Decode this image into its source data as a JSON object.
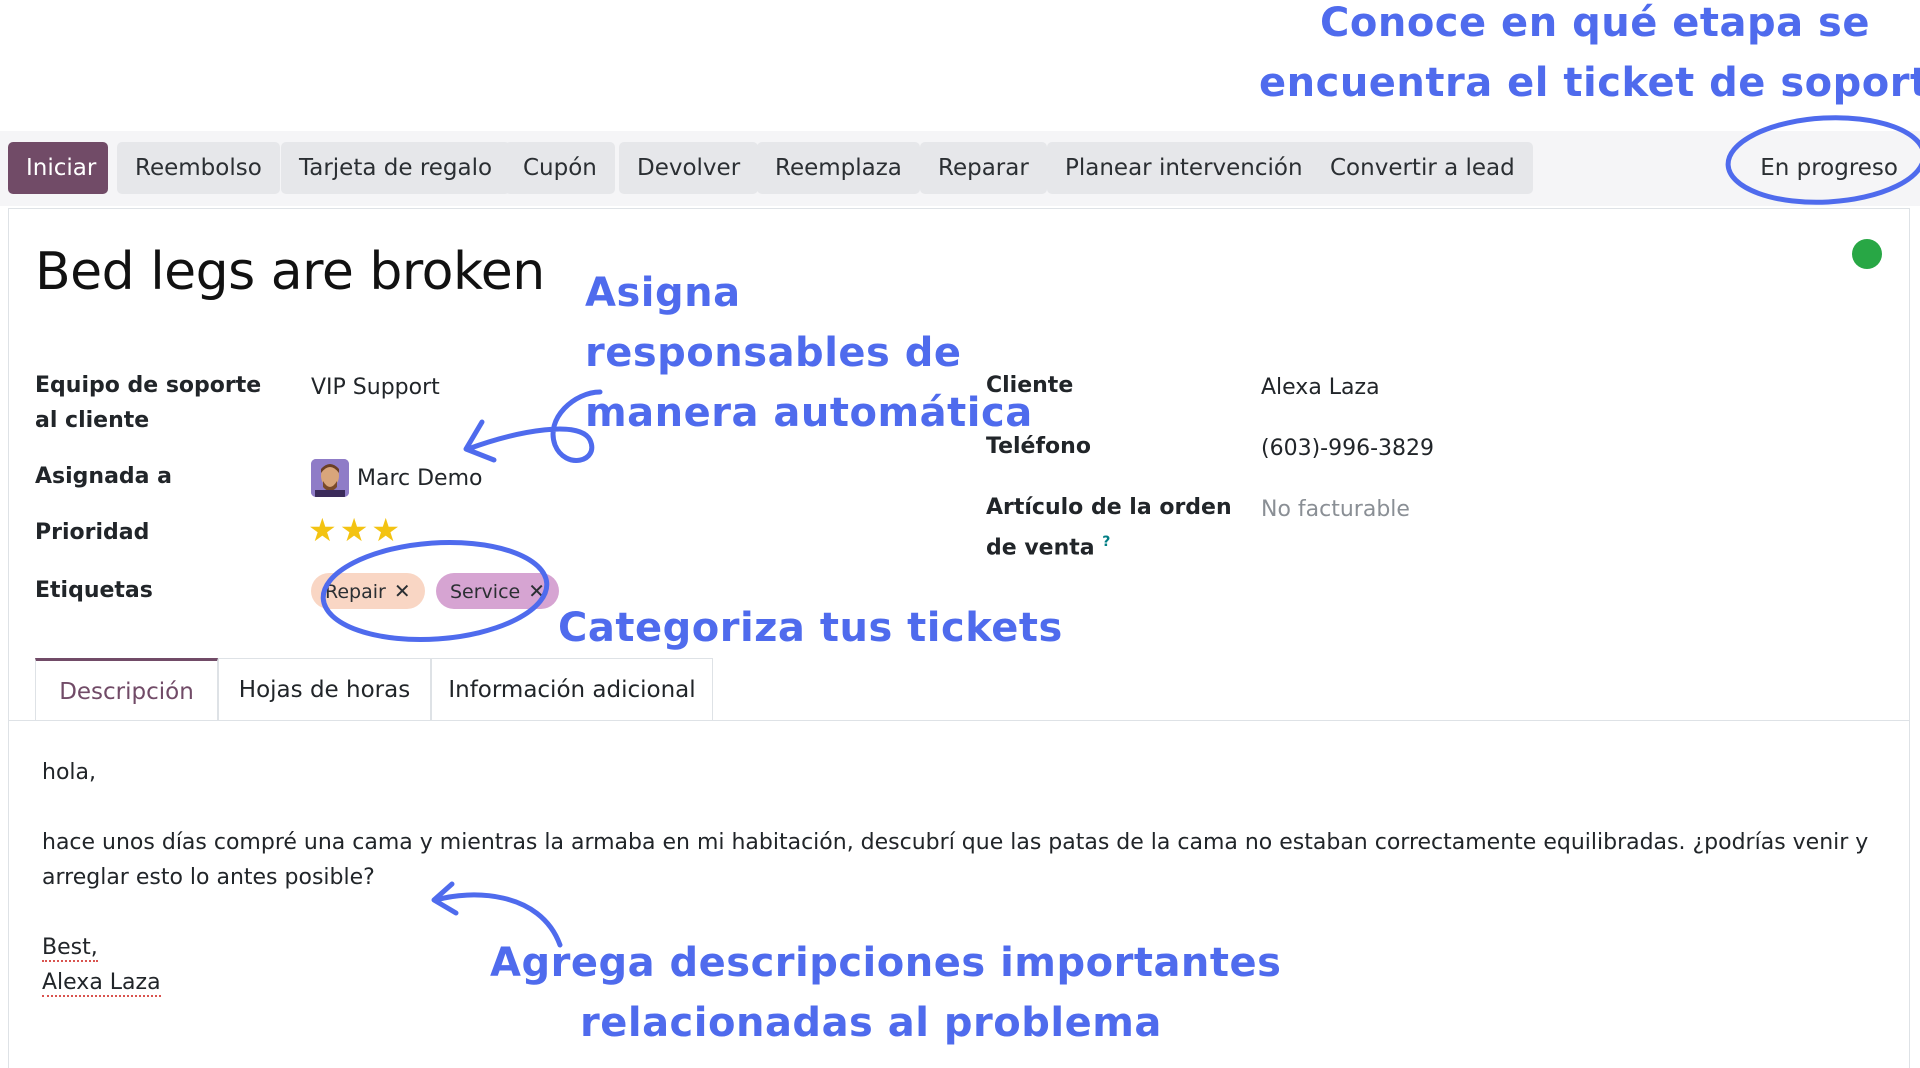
{
  "toolbar": {
    "buttons": [
      "Iniciar",
      "Reembolso",
      "Tarjeta de regalo",
      "Cupón",
      "Devolver",
      "Reemplaza",
      "Reparar",
      "Planear intervención",
      "Convertir a lead"
    ],
    "stage": "En progreso"
  },
  "ticket": {
    "title": "Bed legs are broken",
    "status_color": "#28a745"
  },
  "fields_left": {
    "team_label": "Equipo de soporte al cliente",
    "team_value": "VIP Support",
    "assigned_label": "Asignada a",
    "assigned_value": "Marc Demo",
    "priority_label": "Prioridad",
    "priority_stars": 3,
    "tags_label": "Etiquetas",
    "tags": [
      "Repair",
      "Service"
    ]
  },
  "fields_right": {
    "customer_label": "Cliente",
    "customer_value": "Alexa Laza",
    "phone_label": "Teléfono",
    "phone_value": "(603)-996-3829",
    "sale_line_label_1": "Artículo de la orden",
    "sale_line_label_2": "de venta",
    "sale_line_help": "?",
    "sale_line_value": "No facturable"
  },
  "tabs": [
    "Descripción",
    "Hojas de horas",
    "Información adicional"
  ],
  "description": {
    "line1": "hola,",
    "line2": "hace unos días compré una cama y mientras la armaba en mi habitación, descubrí que las patas de la cama no estaban correctamente equilibradas. ¿podrías venir y",
    "line3": "arreglar esto lo antes posible?",
    "sign1": "Best,",
    "sign2": "Alexa Laza"
  },
  "annotations": {
    "stage_1": "Conoce en qué etapa se",
    "stage_2": "encuentra el ticket de soporte",
    "assign_1": "Asigna",
    "assign_2": "responsables de",
    "assign_3": "manera automática",
    "tags": "Categoriza tus tickets",
    "desc_1": "Agrega descripciones importantes",
    "desc_2": "relacionadas al problema"
  },
  "colors": {
    "primary": "#714b67",
    "annotation": "#4f6bed",
    "tag_repair": "#f9d6c4",
    "tag_service": "#d6a4d2",
    "star": "#f3c312"
  }
}
